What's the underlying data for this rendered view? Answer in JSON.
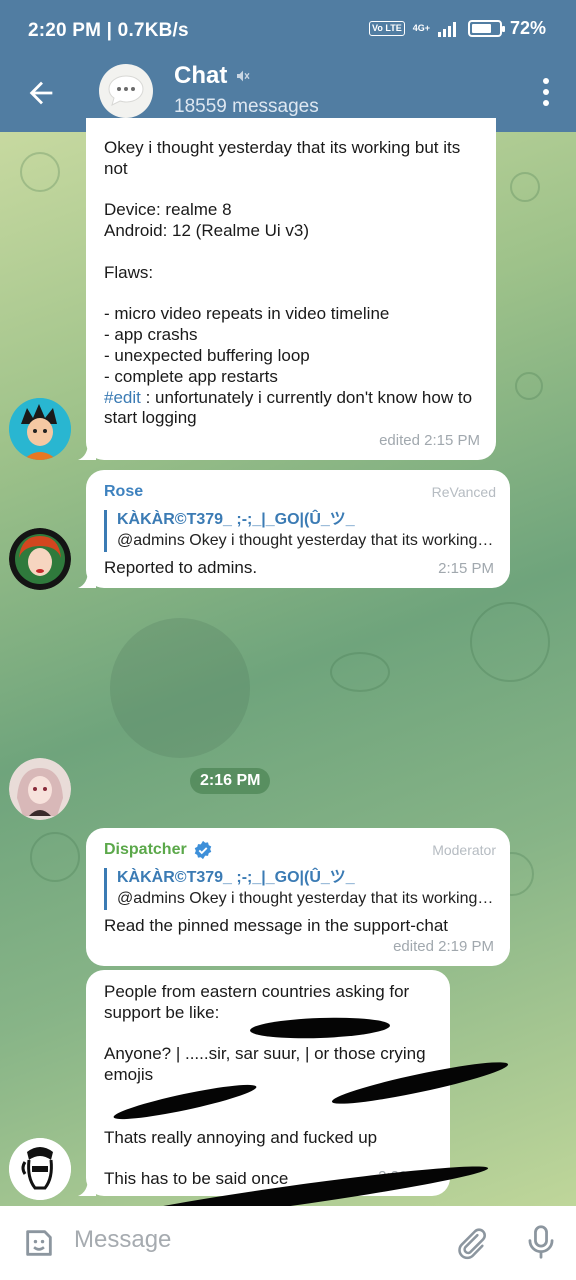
{
  "status_bar": {
    "time_speed": "2:20 PM | 0.7KB/s",
    "volte": "Vo LTE",
    "network": "4G+",
    "battery": "72%",
    "battery_level": 0.72
  },
  "header": {
    "title": "Chat",
    "subtitle": "18559 messages",
    "icons": [
      "back-arrow-icon",
      "chat-avatar-icon",
      "muted-icon",
      "more-vert-icon"
    ]
  },
  "messages": [
    {
      "text": "Okey i thought yesterday that its working but its not\n\nDevice: realme 8\nAndroid: 12 (Realme Ui v3)\n\nFlaws:\n\n- micro video repeats in video timeline\n- app crashs\n- unexpected buffering loop\n- complete app restarts\n",
      "hashtag": "#edit",
      "text_after": " : unfortunately i currently don't know how to start logging",
      "time": "edited 2:15 PM"
    },
    {
      "sender": "Rose",
      "role": "ReVanced",
      "reply_name": "KÀKÀR©T379_ ;-;_|_GO|(Û_ツ_",
      "reply_text": "@admins  Okey i thought yesterday that its working but its not",
      "text": "Reported to admins.",
      "time": "2:15 PM"
    },
    {
      "sender": "Dispatcher",
      "role": "Moderator",
      "reply_name": "KÀKÀR©T379_ ;-;_|_GO|(Û_ツ_",
      "reply_text": "@admins  Okey i thought yesterday that its working but its not",
      "text": "Read the pinned message in the support-chat",
      "time": "edited 2:19 PM"
    },
    {
      "text": "People from eastern countries asking for support be like:\n\nAnyone? | .....sir, sar suur, | or those crying emojis\n\n\nThats really annoying and fucked up\n\nThis has to be said once",
      "time": "2:20 PM"
    }
  ],
  "date_pill": "2:16 PM",
  "input": {
    "placeholder": "Message"
  },
  "colors": {
    "header": "#517da2",
    "link": "#3b7bb4",
    "rose_name": "#3e82bf",
    "dispatcher_name": "#5ba84a",
    "verified": "#3d8fd9"
  }
}
